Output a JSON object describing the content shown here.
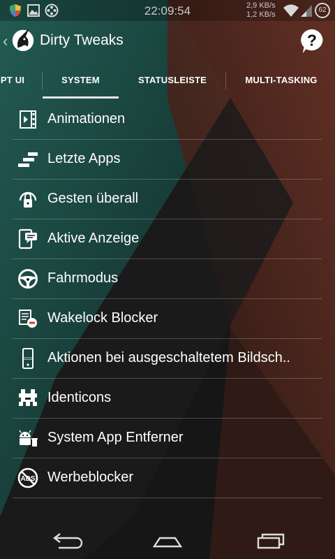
{
  "status_bar": {
    "time": "22:09:54",
    "net_up": "2,9 KB/s",
    "net_down": "1,2 KB/s",
    "battery": "62",
    "icons": [
      "shield-icon",
      "image-icon",
      "reel-icon",
      "wifi-icon",
      "signal-icon",
      "battery-icon"
    ]
  },
  "action_bar": {
    "title": "Dirty Tweaks",
    "back_icon": "chevron-left-icon",
    "logo_icon": "unicorn-logo-icon",
    "help_icon": "help-icon"
  },
  "tabs": {
    "items": [
      {
        "label": "PT UI"
      },
      {
        "label": "SYSTEM",
        "selected": true
      },
      {
        "label": "STATUSLEISTE"
      },
      {
        "label": "MULTI-TASKING"
      }
    ]
  },
  "menu": {
    "items": [
      {
        "label": "Animationen",
        "icon": "film-icon"
      },
      {
        "label": "Letzte Apps",
        "icon": "stairs-icon"
      },
      {
        "label": "Gesten überall",
        "icon": "lock-gesture-icon"
      },
      {
        "label": "Aktive Anzeige",
        "icon": "phone-message-icon"
      },
      {
        "label": "Fahrmodus",
        "icon": "steering-wheel-icon"
      },
      {
        "label": "Wakelock Blocker",
        "icon": "document-block-icon"
      },
      {
        "label": "Aktionen bei ausgeschaltetem Bildsch..",
        "icon": "phone-sleep-icon"
      },
      {
        "label": "Identicons",
        "icon": "identicon-icon"
      },
      {
        "label": "System App Entferner",
        "icon": "android-remove-icon"
      },
      {
        "label": "Werbeblocker",
        "icon": "no-ads-icon"
      }
    ]
  },
  "nav_bar": {
    "back": "back-icon",
    "home": "home-icon",
    "recents": "recents-icon"
  },
  "colors": {
    "teal_panel": "#1d5a52",
    "rust_panel": "#5a2c22",
    "background": "#151515"
  }
}
